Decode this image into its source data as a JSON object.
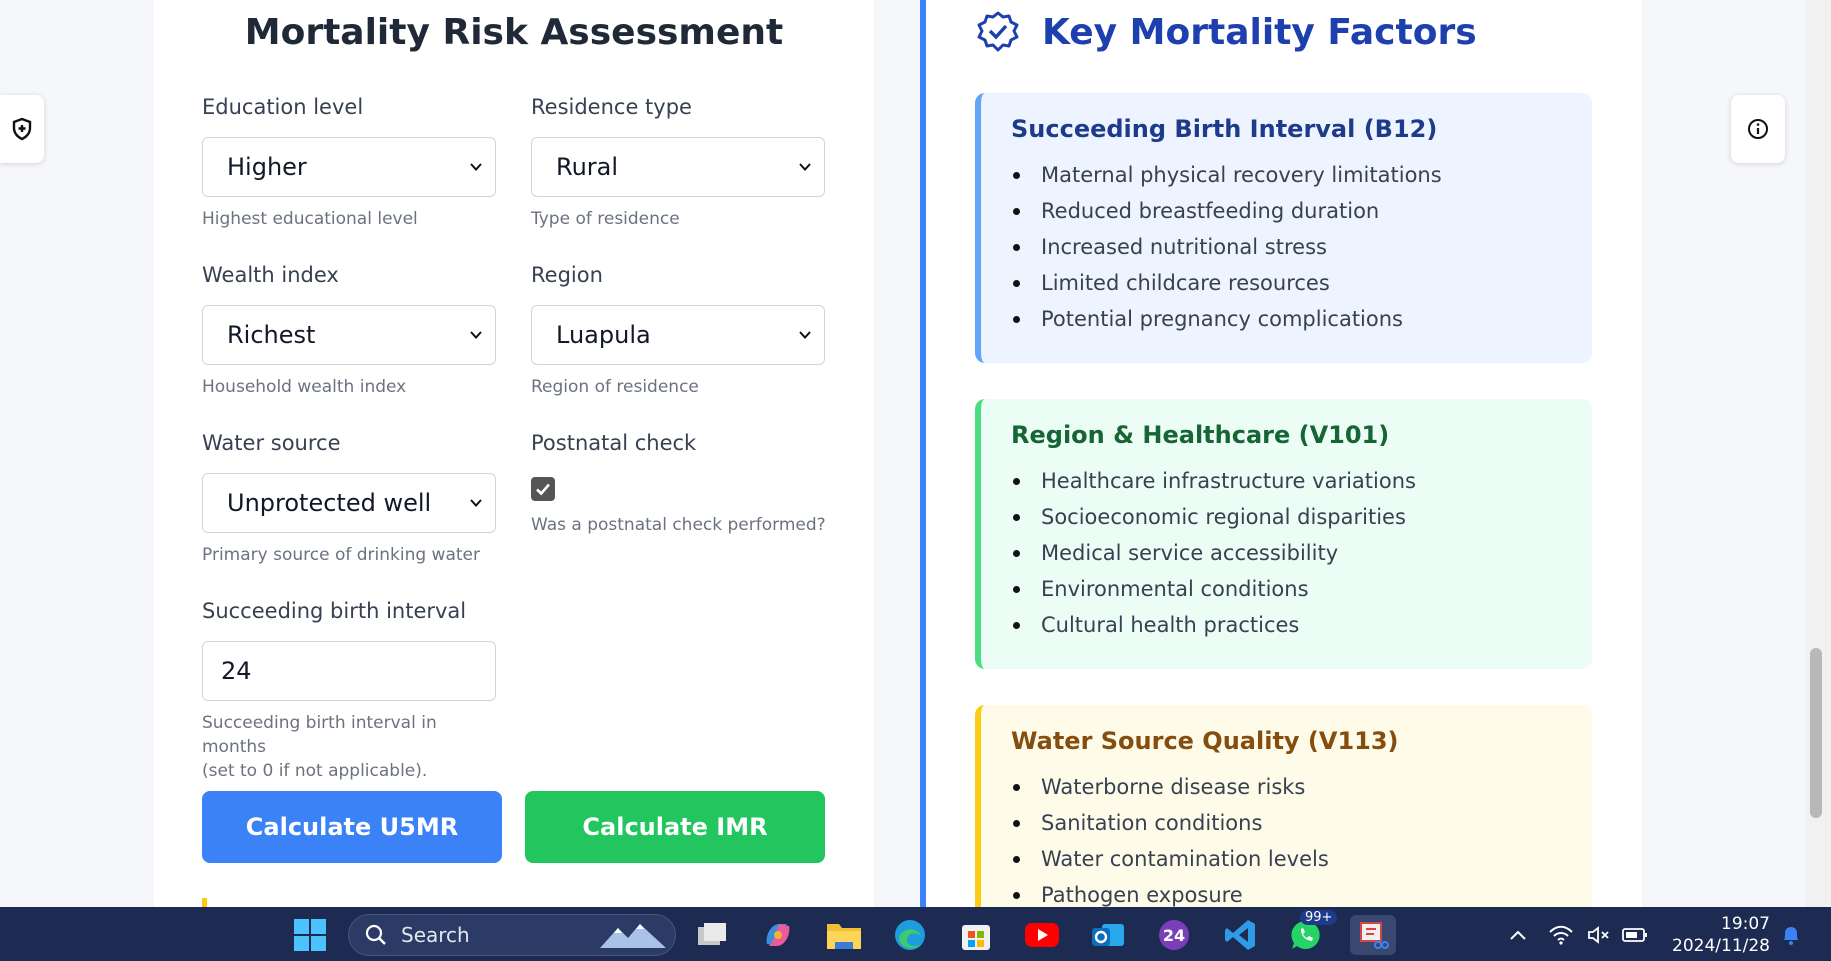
{
  "assessment": {
    "title": "Mortality Risk Assessment",
    "education": {
      "label": "Education level",
      "value": "Higher",
      "help": "Highest educational level"
    },
    "residence": {
      "label": "Residence type",
      "value": "Rural",
      "help": "Type of residence"
    },
    "wealth": {
      "label": "Wealth index",
      "value": "Richest",
      "help": "Household wealth index"
    },
    "region": {
      "label": "Region",
      "value": "Luapula",
      "help": "Region of residence"
    },
    "water": {
      "label": "Water source",
      "value": "Unprotected well",
      "help": "Primary source of drinking water"
    },
    "postnatal": {
      "label": "Postnatal check",
      "checked": true,
      "help": "Was a postnatal check performed?"
    },
    "birth_interval": {
      "label": "Succeeding birth interval",
      "value": "24",
      "help_line1": "Succeeding birth interval in months",
      "help_line2": "(set to 0 if not applicable)."
    },
    "btn_u5mr": "Calculate U5MR",
    "btn_imr": "Calculate IMR"
  },
  "factors": {
    "title": "Key Mortality Factors",
    "cards": [
      {
        "title": "Succeeding Birth Interval (B12)",
        "items": [
          "Maternal physical recovery limitations",
          "Reduced breastfeeding duration",
          "Increased nutritional stress",
          "Limited childcare resources",
          "Potential pregnancy complications"
        ]
      },
      {
        "title": "Region & Healthcare (V101)",
        "items": [
          "Healthcare infrastructure variations",
          "Socioeconomic regional disparities",
          "Medical service accessibility",
          "Environmental conditions",
          "Cultural health practices"
        ]
      },
      {
        "title": "Water Source Quality (V113)",
        "items": [
          "Waterborne disease risks",
          "Sanitation conditions",
          "Water contamination levels",
          "Pathogen exposure"
        ]
      }
    ]
  },
  "taskbar": {
    "search_label": "Search",
    "badge": "99+",
    "time": "19:07",
    "date": "2024/11/28"
  },
  "colors": {
    "primary": "#3b82f6",
    "success": "#22c55e",
    "warning": "#facc15",
    "taskbar": "#1d2a52"
  }
}
